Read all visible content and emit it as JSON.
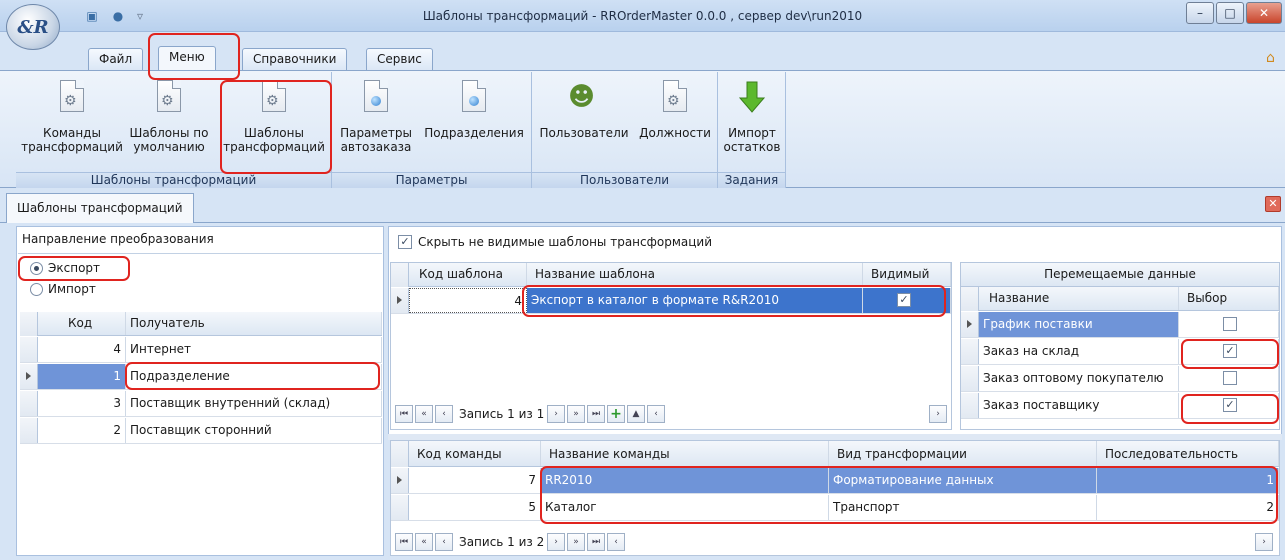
{
  "window": {
    "title": "Шаблоны трансформаций - RROrderMaster 0.0.0 , сервер dev\\run2010",
    "logo": "&R",
    "controls": [
      "minimize-icon",
      "maximize-icon",
      "close-icon"
    ]
  },
  "ribbon_tabs": [
    {
      "label": "Файл",
      "active": false
    },
    {
      "label": "Меню",
      "active": true
    },
    {
      "label": "Справочники",
      "active": false
    },
    {
      "label": "Сервис",
      "active": false
    }
  ],
  "ribbon": {
    "groups": [
      {
        "caption": "Шаблоны трансформаций",
        "buttons": [
          {
            "line1": "Команды",
            "line2": "трансформаций",
            "icon": "doc-gear-icon"
          },
          {
            "line1": "Шаблоны по",
            "line2": "умолчанию",
            "icon": "doc-gear-icon"
          },
          {
            "line1": "Шаблоны",
            "line2": "трансформаций",
            "icon": "doc-gear-icon"
          }
        ]
      },
      {
        "caption": "Параметры",
        "buttons": [
          {
            "line1": "Параметры",
            "line2": "автозаказа",
            "icon": "doc-blue-icon"
          },
          {
            "line1": "Подразделения",
            "line2": "",
            "icon": "doc-blue-icon"
          }
        ]
      },
      {
        "caption": "Пользователи",
        "buttons": [
          {
            "line1": "Пользователи",
            "line2": "",
            "icon": "users-icon"
          },
          {
            "line1": "Должности",
            "line2": "",
            "icon": "doc-gear-icon"
          }
        ]
      },
      {
        "caption": "Задания",
        "buttons": [
          {
            "line1": "Импорт",
            "line2": "остатков",
            "icon": "arrow-down-icon"
          }
        ]
      }
    ]
  },
  "doc_tab": {
    "label": "Шаблоны трансформаций"
  },
  "left": {
    "direction_title": "Направление преобразования",
    "radio": [
      {
        "label": "Экспорт",
        "checked": true
      },
      {
        "label": "Импорт",
        "checked": false
      }
    ],
    "columns": [
      "Код",
      "Получатель"
    ],
    "rows": [
      {
        "code": "4",
        "name": "Интернет",
        "selected": false
      },
      {
        "code": "1",
        "name": "Подразделение",
        "selected": true
      },
      {
        "code": "3",
        "name": "Поставщик внутренний (склад)",
        "selected": false
      },
      {
        "code": "2",
        "name": "Поставщик сторонний",
        "selected": false
      }
    ]
  },
  "templates": {
    "hide_label": "Скрыть не видимые шаблоны трансформаций",
    "hide_checked": true,
    "columns": [
      "Код шаблона",
      "Название шаблона",
      "Видимый"
    ],
    "rows": [
      {
        "code": "4",
        "name": "Экспорт в каталог в формате  R&R2010",
        "visible": true
      }
    ],
    "nav": "Запись 1 из 1"
  },
  "moved_data": {
    "title": "Перемещаемые данные",
    "columns": [
      "Название",
      "Выбор"
    ],
    "rows": [
      {
        "name": "График поставки",
        "checked": false
      },
      {
        "name": "Заказ на склад",
        "checked": true
      },
      {
        "name": "Заказ оптовому покупателю",
        "checked": false
      },
      {
        "name": "Заказ поставщику",
        "checked": true
      }
    ]
  },
  "commands": {
    "columns": [
      "Код команды",
      "Название команды",
      "Вид трансформации",
      "Последовательность"
    ],
    "rows": [
      {
        "code": "7",
        "name": "RR2010",
        "kind": "Форматирование данных",
        "seq": "1",
        "selected": true
      },
      {
        "code": "5",
        "name": "Каталог",
        "kind": "Транспорт",
        "seq": "2",
        "selected": false
      }
    ],
    "nav": "Запись 1 из 2"
  },
  "colors": {
    "selection": "#6f94d8",
    "highlight": "#e0241f",
    "frame": "#d6e4f5"
  }
}
